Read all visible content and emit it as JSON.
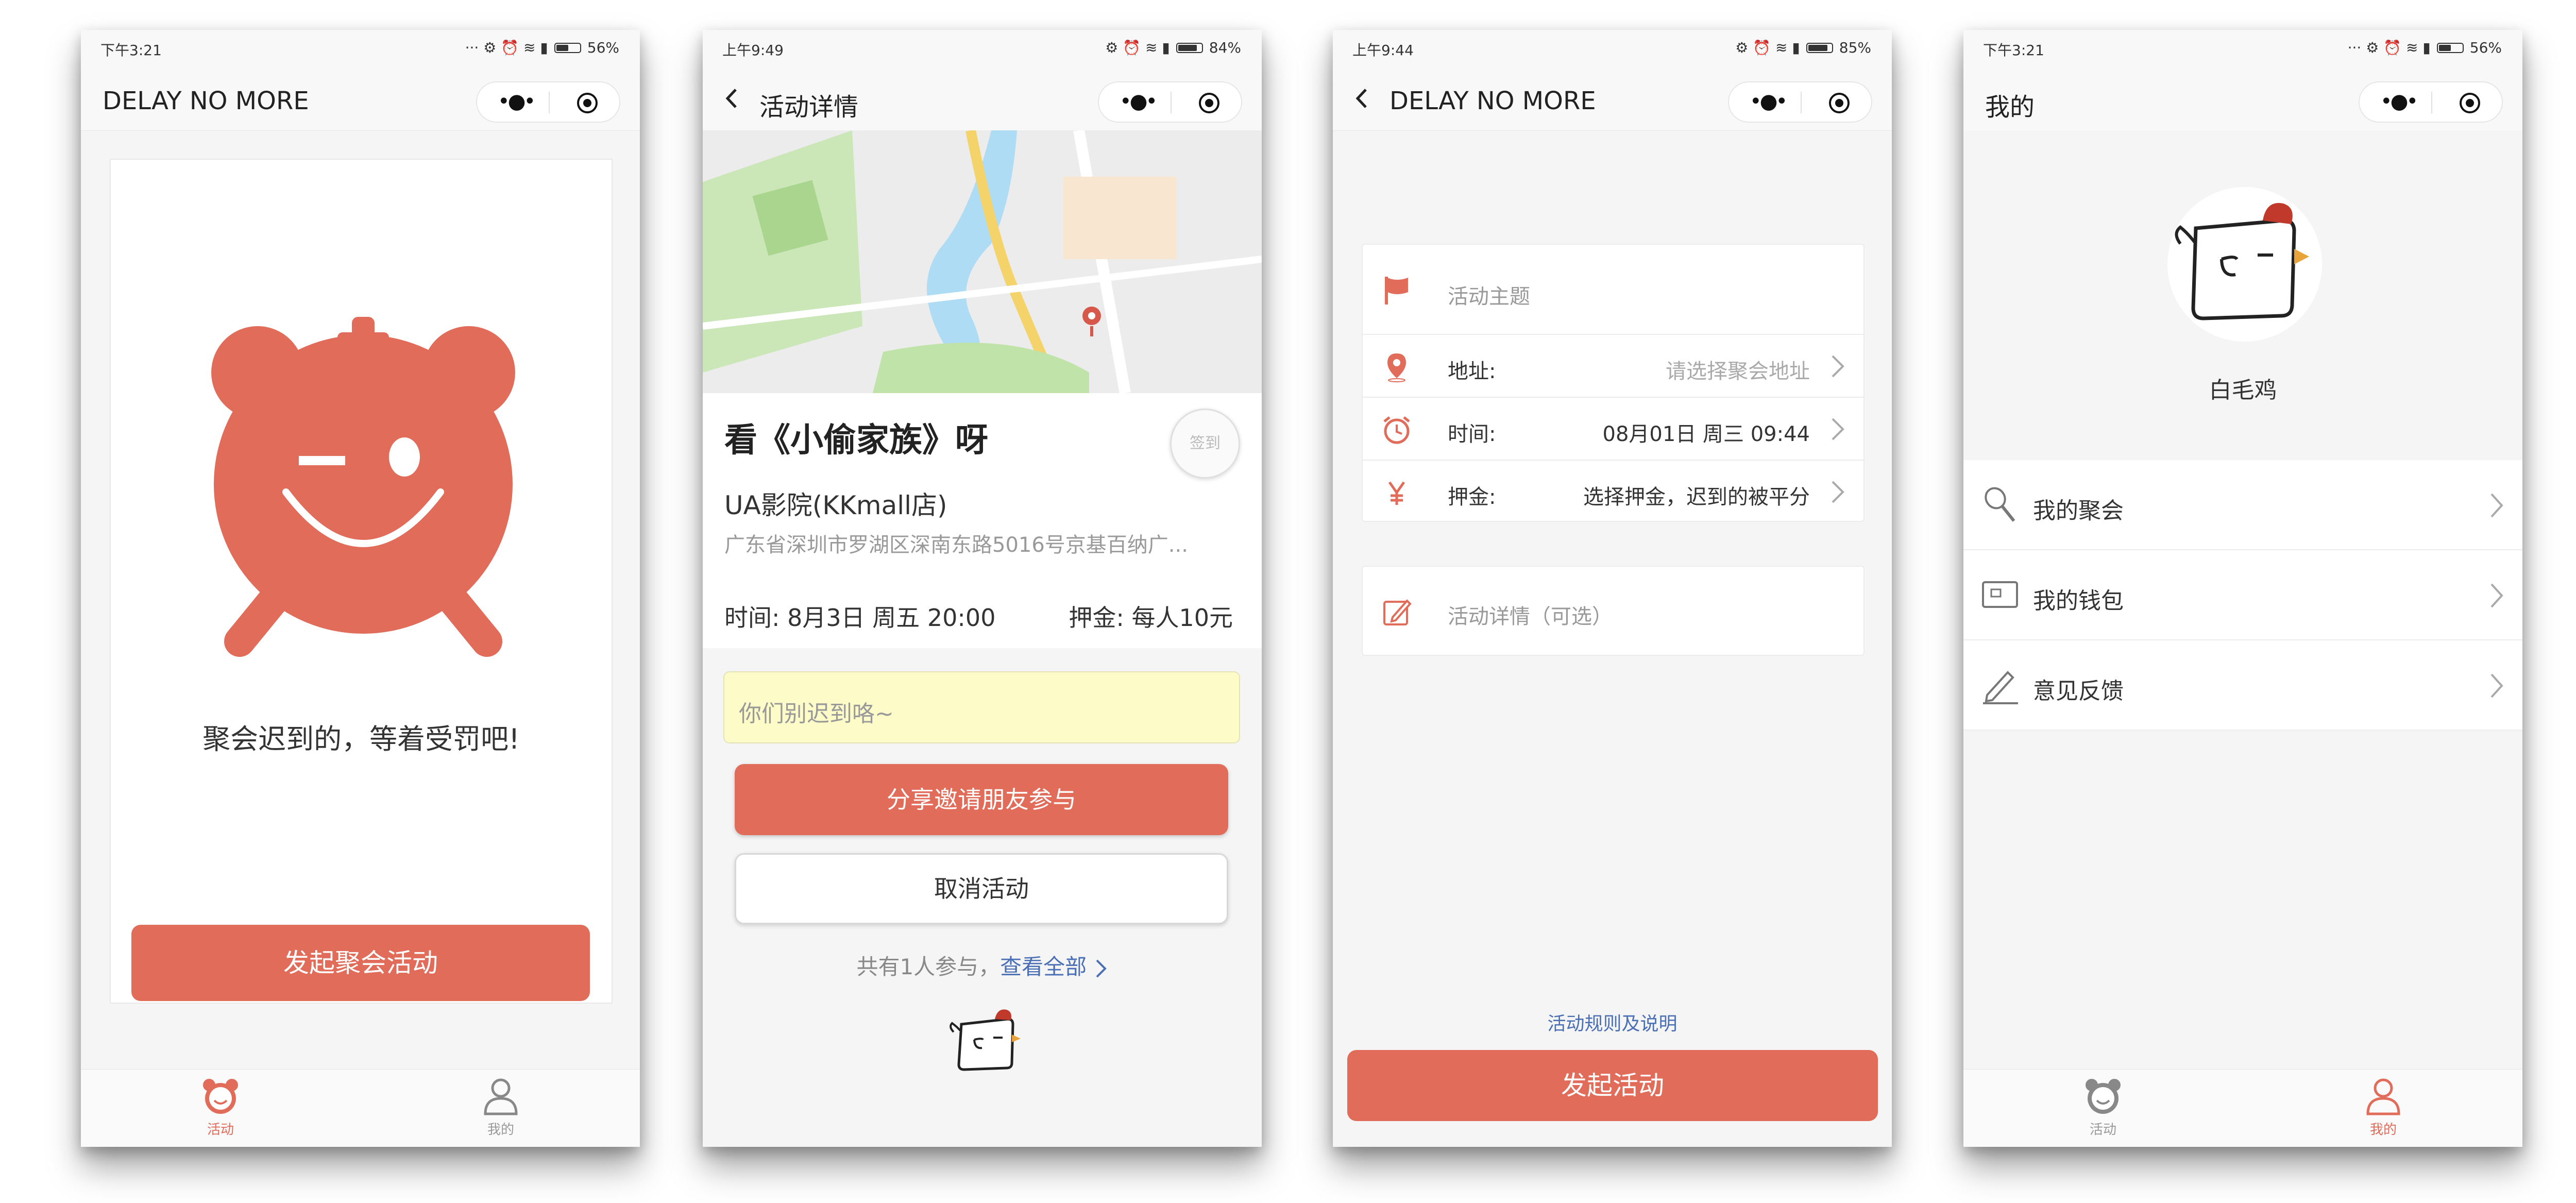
{
  "colors": {
    "accent": "#e06c59",
    "link": "#4a6fb5",
    "note_bg": "#fdfcc8"
  },
  "screens": [
    {
      "status": {
        "time": "下午3:21",
        "battery": "56%",
        "battery_level": 0.56
      },
      "nav": {
        "title": "DELAY NO MORE"
      },
      "slogan": "聚会迟到的，等着受罚吧!",
      "primary_button": "发起聚会活动",
      "tabs": [
        {
          "label": "活动",
          "icon": "alarm-clock-icon",
          "active": true
        },
        {
          "label": "我的",
          "icon": "person-icon",
          "active": false
        }
      ]
    },
    {
      "status": {
        "time": "上午9:49",
        "battery": "84%",
        "battery_level": 0.84
      },
      "nav": {
        "title": "活动详情"
      },
      "activity": {
        "title": "看《小偷家族》呀",
        "signin": "签到",
        "place": "UA影院(KKmall店)",
        "address": "广东省深圳市罗湖区深南东路5016号京基百纳广...",
        "time": "时间: 8月3日 周五 20:00",
        "deposit": "押金: 每人10元"
      },
      "note_placeholder": "你们别迟到咯~",
      "share_button": "分享邀请朋友参与",
      "cancel_button": "取消活动",
      "participants_text": "共有1人参与，",
      "view_all": "查看全部"
    },
    {
      "status": {
        "time": "上午9:44",
        "battery": "85%",
        "battery_level": 0.85
      },
      "nav": {
        "title": "DELAY NO MORE"
      },
      "form": {
        "topic_placeholder": "活动主题",
        "address_label": "地址:",
        "address_placeholder": "请选择聚会地址",
        "time_label": "时间:",
        "time_value": "08月01日 周三 09:44",
        "deposit_label": "押金:",
        "deposit_value": "选择押金，迟到的被平分",
        "details_placeholder": "活动详情（可选）"
      },
      "rules_link": "活动规则及说明",
      "submit_button": "发起活动"
    },
    {
      "status": {
        "time": "下午3:21",
        "battery": "56%",
        "battery_level": 0.56
      },
      "nav": {
        "title": "我的"
      },
      "username": "白毛鸡",
      "menu": [
        {
          "label": "我的聚会",
          "icon": "microphone-icon"
        },
        {
          "label": "我的钱包",
          "icon": "wallet-icon"
        },
        {
          "label": "意见反馈",
          "icon": "pencil-icon"
        }
      ],
      "tabs": [
        {
          "label": "活动",
          "icon": "alarm-clock-icon",
          "active": false
        },
        {
          "label": "我的",
          "icon": "person-icon",
          "active": true
        }
      ]
    }
  ]
}
